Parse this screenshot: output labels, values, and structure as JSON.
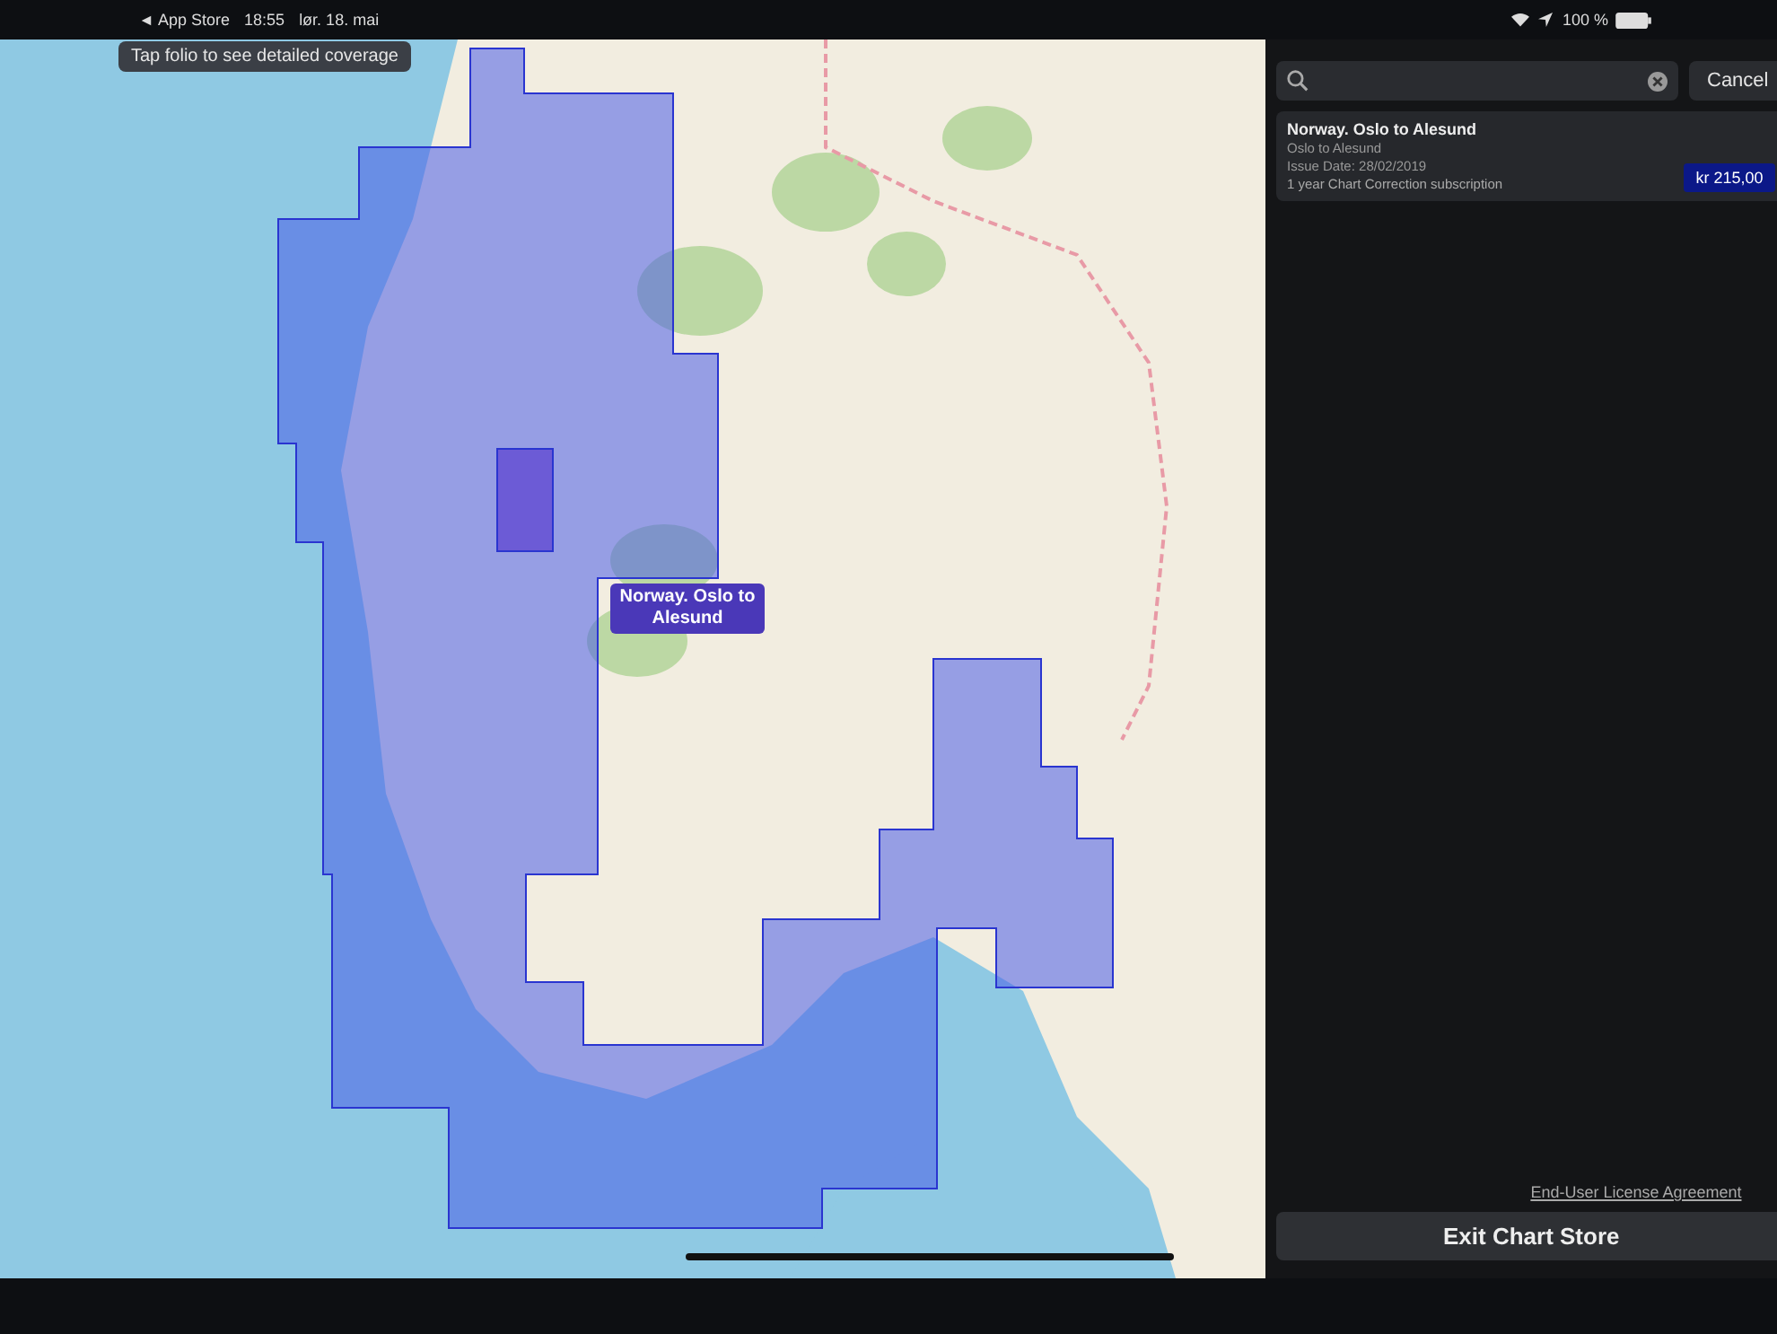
{
  "status_bar": {
    "back_label": "App Store",
    "time": "18:55",
    "date": "lør. 18. mai",
    "battery": "100 %"
  },
  "map": {
    "hint": "Tap folio to see detailed coverage",
    "folio_label": "Norway. Oslo to Alesund"
  },
  "search": {
    "cancel": "Cancel"
  },
  "results": [
    {
      "title": "Norway. Oslo to Alesund",
      "subtitle": "Oslo to Alesund",
      "issue_date": "Issue Date: 28/02/2019",
      "subscription": "1 year Chart Correction subscription",
      "price": "kr 215,00"
    }
  ],
  "license_link": "End-User License Agreement",
  "exit_button": "Exit Chart Store"
}
